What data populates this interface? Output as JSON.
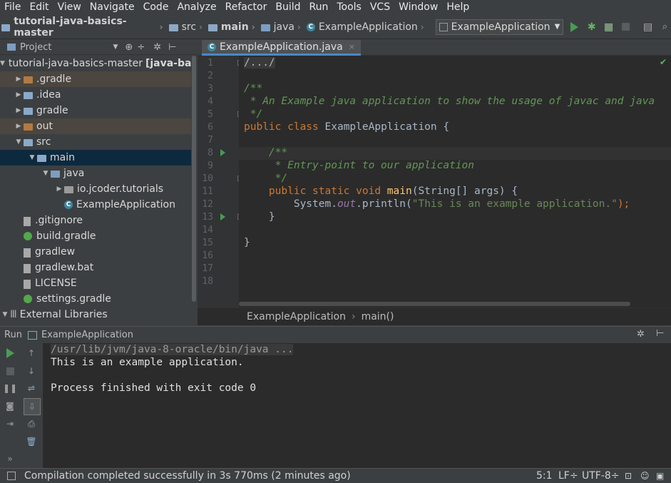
{
  "menu": [
    "File",
    "Edit",
    "View",
    "Navigate",
    "Code",
    "Analyze",
    "Refactor",
    "Build",
    "Run",
    "Tools",
    "VCS",
    "Window",
    "Help"
  ],
  "nav": {
    "project": "tutorial-java-basics-master",
    "src": "src",
    "main": "main",
    "java": "java",
    "class": "ExampleApplication",
    "run_config": "ExampleApplication"
  },
  "project_panel": {
    "title": "Project",
    "tree": [
      {
        "label": "tutorial-java-basics-master",
        "suffix": "[java-ba",
        "indent": 0,
        "arrow": "down",
        "icon": "folder-icon",
        "style": ""
      },
      {
        "label": ".gradle",
        "indent": 1,
        "arrow": "right",
        "icon": "folder-brown-icon",
        "style": "exc"
      },
      {
        "label": ".idea",
        "indent": 1,
        "arrow": "right",
        "icon": "folder-icon",
        "style": ""
      },
      {
        "label": "gradle",
        "indent": 1,
        "arrow": "right",
        "icon": "folder-icon",
        "style": ""
      },
      {
        "label": "out",
        "indent": 1,
        "arrow": "right",
        "icon": "folder-brown-icon",
        "style": "exc"
      },
      {
        "label": "src",
        "indent": 1,
        "arrow": "down",
        "icon": "folder-icon",
        "style": ""
      },
      {
        "label": "main",
        "indent": 2,
        "arrow": "down",
        "icon": "folder-icon",
        "style": "sel"
      },
      {
        "label": "java",
        "indent": 3,
        "arrow": "down",
        "icon": "folder-src-icon",
        "style": ""
      },
      {
        "label": "io.jcoder.tutorials",
        "indent": 4,
        "arrow": "right",
        "icon": "package-icon",
        "style": ""
      },
      {
        "label": "ExampleApplication",
        "indent": 4,
        "arrow": "",
        "icon": "class-icon",
        "style": ""
      },
      {
        "label": ".gitignore",
        "indent": 1,
        "arrow": "",
        "icon": "file-icon",
        "style": ""
      },
      {
        "label": "build.gradle",
        "indent": 1,
        "arrow": "",
        "icon": "gradle-icon",
        "style": ""
      },
      {
        "label": "gradlew",
        "indent": 1,
        "arrow": "",
        "icon": "file-icon",
        "style": ""
      },
      {
        "label": "gradlew.bat",
        "indent": 1,
        "arrow": "",
        "icon": "file-icon",
        "style": ""
      },
      {
        "label": "LICENSE",
        "indent": 1,
        "arrow": "",
        "icon": "file-icon",
        "style": ""
      },
      {
        "label": "settings.gradle",
        "indent": 1,
        "arrow": "",
        "icon": "gradle-icon",
        "style": ""
      },
      {
        "label": "External Libraries",
        "indent": 0,
        "arrow": "down",
        "icon": "library-icon",
        "style": ""
      }
    ]
  },
  "editor": {
    "tab_label": "ExampleApplication.java",
    "line_numbers": [
      "1",
      "2",
      "3",
      "4",
      "5",
      "6",
      "7",
      "8",
      "9",
      "10",
      "11",
      "12",
      "13",
      "14",
      "15",
      "16",
      "17",
      "18"
    ],
    "code": {
      "l1": "/.../",
      "l5": "/**",
      "l6": " * An Example java application to show the usage of javac and java",
      "l7": " */",
      "l8_kw": "public class ",
      "l8_name": "ExampleApplication {",
      "l10": "    /**",
      "l11": "     * Entry-point to our application",
      "l12": "     */",
      "l13_kw": "    public static void ",
      "l13_fn": "main",
      "l13_rest": "(String[] args) {",
      "l14_a": "        System.",
      "l14_field": "out",
      "l14_b": ".println(",
      "l14_str": "\"This is an example application.\"",
      "l14_end": ");",
      "l15": "    }",
      "l17": "}"
    },
    "breadcrumb": [
      "ExampleApplication",
      "main()"
    ]
  },
  "run_panel": {
    "label": "Run",
    "config": "ExampleApplication",
    "output": [
      "/usr/lib/jvm/java-8-oracle/bin/java ...",
      "This is an example application.",
      "",
      "Process finished with exit code 0"
    ]
  },
  "status": {
    "message": "Compilation completed successfully in 3s 770ms (2 minutes ago)",
    "position": "5:1",
    "line_sep": "LF÷",
    "encoding": "UTF-8÷"
  },
  "colors": {
    "keyword": "#cc7832",
    "comment": "#629755",
    "string": "#6a8759",
    "function": "#ffc66d",
    "run_green": "#499c54"
  }
}
